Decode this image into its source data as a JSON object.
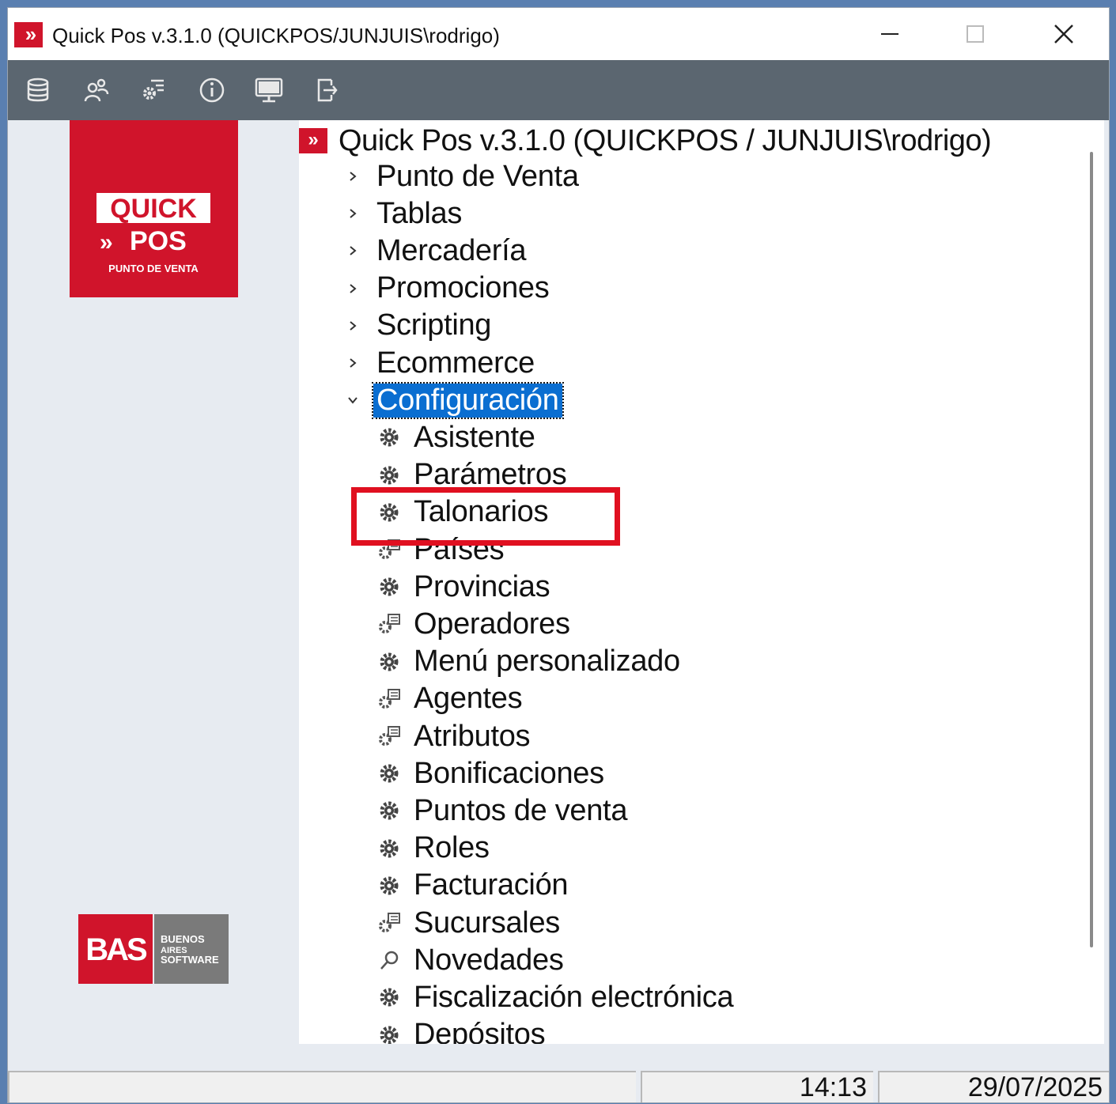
{
  "window": {
    "title": "Quick Pos v.3.1.0 (QUICKPOS/JUNJUIS\\rodrigo)"
  },
  "toolbar": {
    "buttons": [
      {
        "icon": "database-icon"
      },
      {
        "icon": "users-icon"
      },
      {
        "icon": "settings-list-icon"
      },
      {
        "icon": "info-icon"
      },
      {
        "icon": "monitor-icon"
      },
      {
        "icon": "exit-icon"
      }
    ]
  },
  "logo": {
    "quick": "QUICK",
    "pos": "POS",
    "tagline": "PUNTO DE VENTA",
    "bas": "BAS",
    "bas_sub1": "BUENOS",
    "bas_sub2": "AIRES",
    "bas_sub3": "SOFTWARE"
  },
  "tree": {
    "root": "Quick Pos v.3.1.0 (QUICKPOS / JUNJUIS\\rodrigo)",
    "nodes": [
      {
        "label": "Punto de Venta"
      },
      {
        "label": "Tablas"
      },
      {
        "label": "Mercadería"
      },
      {
        "label": "Promociones"
      },
      {
        "label": "Scripting"
      },
      {
        "label": "Ecommerce"
      },
      {
        "label": "Configuración"
      }
    ],
    "children": [
      {
        "label": "Asistente",
        "icon": "gear-icon"
      },
      {
        "label": "Parámetros",
        "icon": "gear-icon"
      },
      {
        "label": "Talonarios",
        "icon": "gear-icon"
      },
      {
        "label": "Países",
        "icon": "gear-list-icon"
      },
      {
        "label": "Provincias",
        "icon": "gear-icon"
      },
      {
        "label": "Operadores",
        "icon": "gear-list-icon"
      },
      {
        "label": "Menú personalizado",
        "icon": "gear-icon"
      },
      {
        "label": "Agentes",
        "icon": "gear-list-icon"
      },
      {
        "label": "Atributos",
        "icon": "gear-list-icon"
      },
      {
        "label": "Bonificaciones",
        "icon": "gear-icon"
      },
      {
        "label": "Puntos de venta",
        "icon": "gear-icon"
      },
      {
        "label": "Roles",
        "icon": "gear-icon"
      },
      {
        "label": "Facturación",
        "icon": "gear-icon"
      },
      {
        "label": "Sucursales",
        "icon": "gear-list-icon"
      },
      {
        "label": "Novedades",
        "icon": "search-icon"
      },
      {
        "label": "Fiscalización electrónica",
        "icon": "gear-icon"
      },
      {
        "label": "Depósitos",
        "icon": "gear-icon"
      }
    ]
  },
  "status": {
    "time": "14:13",
    "date": "29/07/2025"
  },
  "colors": {
    "brand_red": "#d0142b",
    "toolbar_bg": "#5b6670",
    "selection": "#0a6ed1",
    "highlight_box": "#e01020"
  }
}
